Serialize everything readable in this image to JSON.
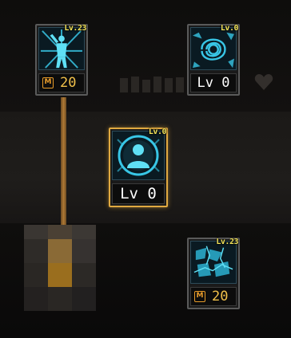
{
  "skill_tree": {
    "nodes": [
      {
        "id": "top-left",
        "level_tag": "Lv.23",
        "cost_icon": "M",
        "cost": "20",
        "art_icon": "figure-burst-icon",
        "state": "unlocked"
      },
      {
        "id": "top-right",
        "level_tag": "Lv.0",
        "level_text": "Lv 0",
        "art_icon": "rose-pattern-icon",
        "state": "locked"
      },
      {
        "id": "center",
        "level_tag": "Lv.0",
        "level_text": "Lv 0",
        "art_icon": "silhouette-portrait-icon",
        "state": "selected"
      },
      {
        "id": "bottom-right",
        "level_tag": "Lv.23",
        "cost_icon": "M",
        "cost": "20",
        "art_icon": "cracked-stone-icon",
        "state": "unlocked"
      }
    ]
  },
  "colors": {
    "accent_gold": "#e0a940",
    "level_tag_yellow": "#f2e25a",
    "art_cyan": "#38c6e6",
    "cost_orange": "#e79b2a",
    "connector_brown": "#b07a34"
  }
}
